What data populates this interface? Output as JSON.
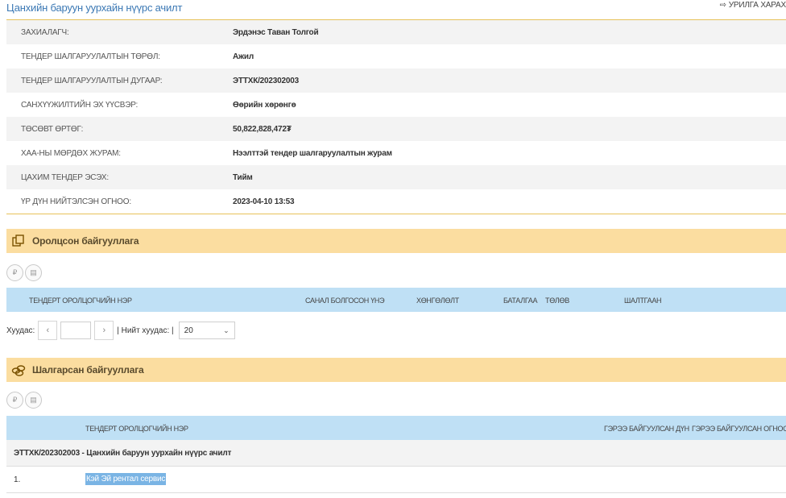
{
  "header": {
    "title": "Цанхийн баруун уурхайн нүүрс ачилт",
    "back_label": "УРИЛГА ХАРАХ"
  },
  "info": [
    {
      "label": "ЗАХИАЛАГЧ:",
      "value": "Эрдэнэс Таван Толгой"
    },
    {
      "label": "ТЕНДЕР ШАЛГАРУУЛАЛТЫН ТӨРӨЛ:",
      "value": "Ажил"
    },
    {
      "label": "ТЕНДЕР ШАЛГАРУУЛАЛТЫН ДУГААР:",
      "value": "ЭТТХК/202302003"
    },
    {
      "label": "САНХҮҮЖИЛТИЙН ЭХ ҮҮСВЭР:",
      "value": "Өөрийн хөрөнгө"
    },
    {
      "label": "ТӨСӨВТ ӨРТӨГ:",
      "value": "50,822,828,472₮"
    },
    {
      "label": "ХАА-НЫ МӨРДӨХ ЖУРАМ:",
      "value": "Нээлттэй тендер шалгаруулалтын журам"
    },
    {
      "label": "ЦАХИМ ТЕНДЕР ЭСЭХ:",
      "value": "Тийм"
    },
    {
      "label": "ҮР ДҮН НИЙТЭЛСЭН ОГНОО:",
      "value": "2023-04-10 13:53"
    }
  ],
  "participants": {
    "title": "Оролцсон байгууллага",
    "columns": {
      "name": "ТЕНДЕРТ ОРОЛЦОГЧИЙН НЭР",
      "price": "САНАЛ БОЛГОСОН ҮНЭ",
      "discount": "ХӨНГӨЛӨЛТ",
      "guarantee": "БАТАЛГАА",
      "payment": "ТӨЛӨВ",
      "reason": "ШАЛТГААН"
    },
    "pager": {
      "pages_label": "Хуудас:",
      "total_label": "| Нийт хуудас: |",
      "page_size": "20"
    }
  },
  "winners": {
    "title": "Шалгарсан байгууллага",
    "columns": {
      "name": "ТЕНДЕРТ ОРОЛЦОГЧИЙН НЭР",
      "amount": "ГЭРЭЭ БАЙГУУЛСАН ДҮН",
      "date": "ГЭРЭЭ БАЙГУУЛСАН ОГНОО"
    },
    "group": "ЭТТХК/202302003 - Цанхийн баруун уурхайн нүүрс ачилт",
    "rows": [
      {
        "num": "1.",
        "name": "Кэй Эй рентал сервис"
      }
    ]
  },
  "colors": {
    "accent_blue": "#3b78b4",
    "panel_header": "#fbdda0",
    "table_header": "#bfe0f5",
    "divider": "#e7c25a"
  }
}
